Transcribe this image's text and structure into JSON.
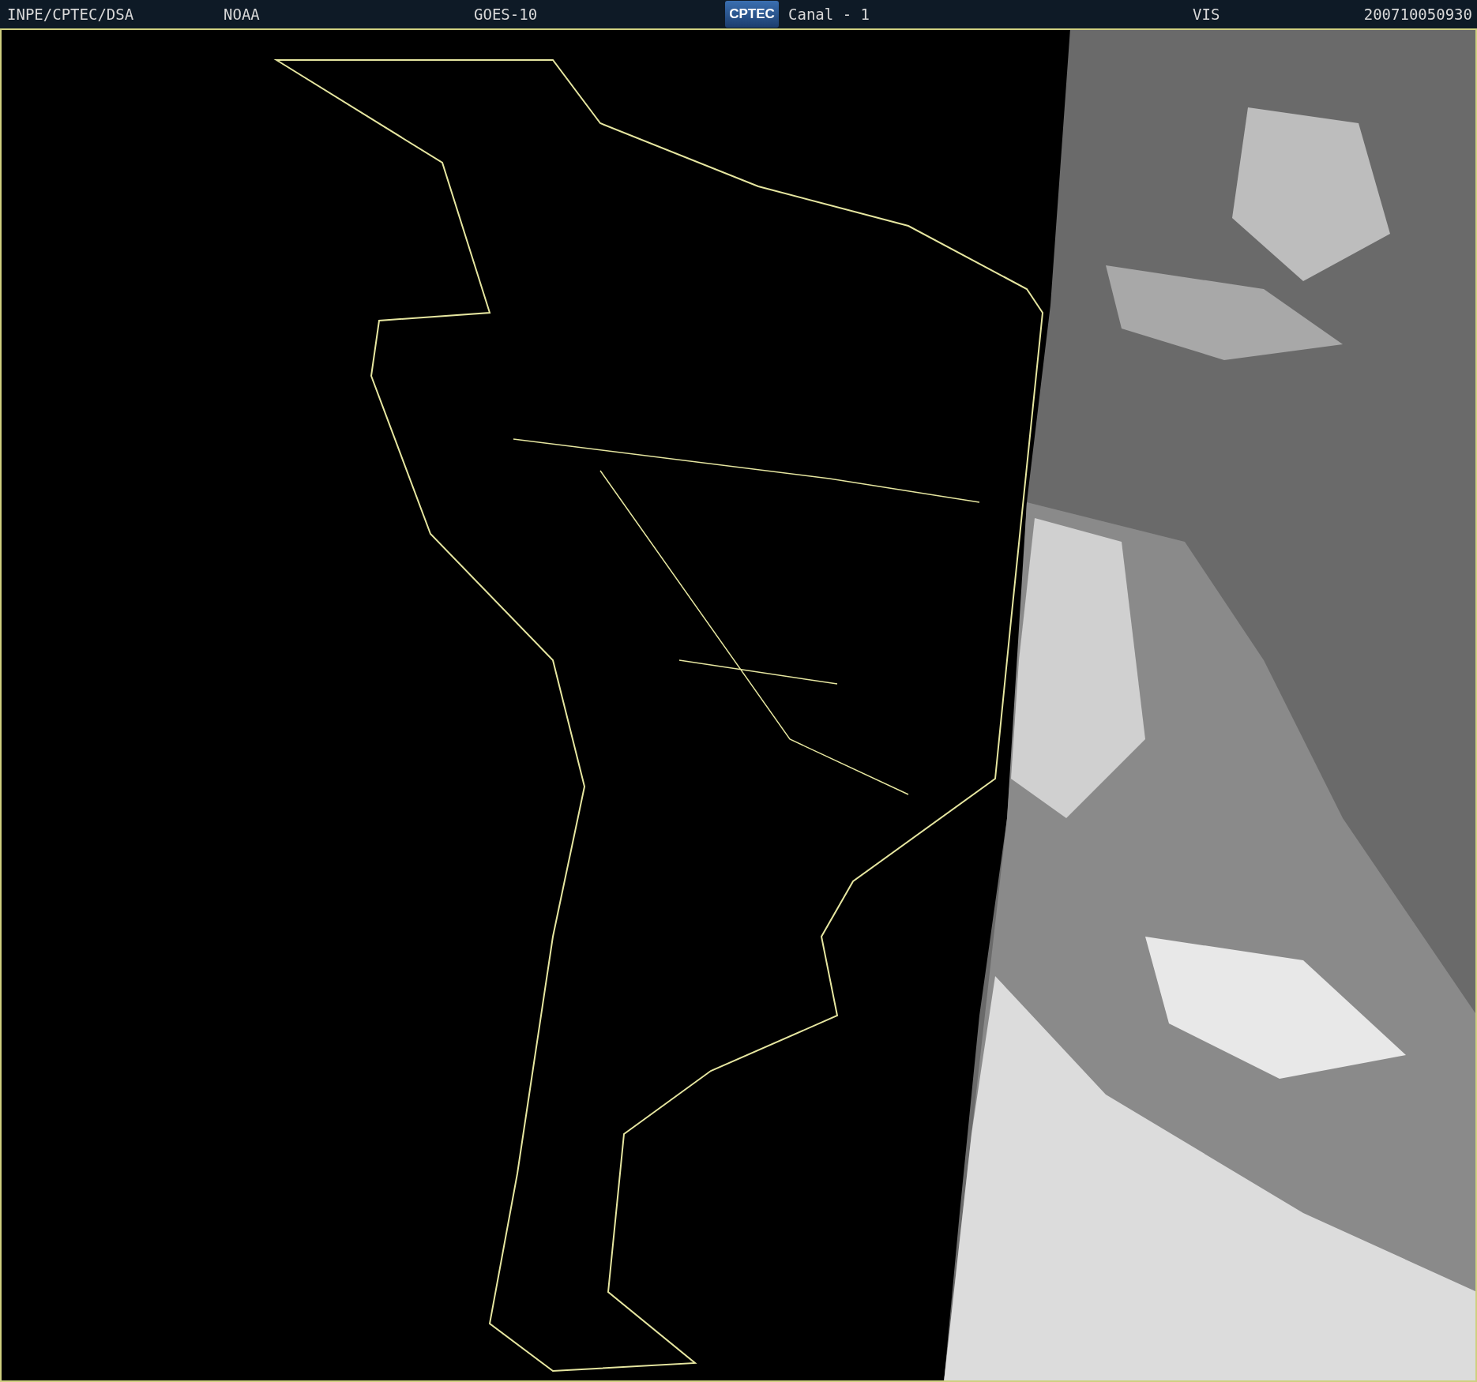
{
  "header": {
    "source": "INPE/CPTEC/DSA",
    "agency": "NOAA",
    "satellite": "GOES-10",
    "logo": "CPTEC",
    "channel": "Canal - 1",
    "band": "VIS",
    "timestamp": "200710050930"
  }
}
